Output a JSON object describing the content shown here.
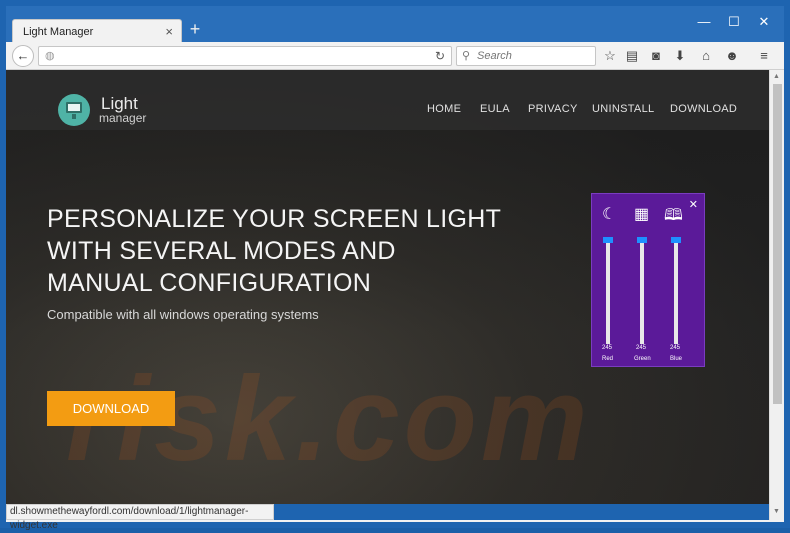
{
  "browser": {
    "tab_title": "Light Manager",
    "tab_close": "×",
    "new_tab": "+",
    "minimize": "—",
    "maximize": "☐",
    "close": "✕",
    "search_placeholder": "Search",
    "status_url": "dl.showmethewayfordl.com/download/1/lightmanager-widget.exe"
  },
  "site": {
    "logo_light": "Light",
    "logo_manager": "manager",
    "nav": [
      "HOME",
      "EULA",
      "PRIVACY",
      "UNINSTALL",
      "DOWNLOAD"
    ],
    "hero_lines": [
      "PERSONALIZE YOUR SCREEN LIGHT",
      "WITH SEVERAL MODES AND",
      "MANUAL CONFIGURATION"
    ],
    "subtitle": "Compatible with all windows operating systems",
    "download_button": "DOWNLOAD",
    "watermark": "risk.com"
  },
  "widget": {
    "icons": [
      "moon-icon",
      "clapperboard-icon",
      "book-icon"
    ],
    "close": "✕",
    "sliders": [
      {
        "value": "245",
        "label": "Red"
      },
      {
        "value": "245",
        "label": "Green"
      },
      {
        "value": "245",
        "label": "Blue"
      }
    ]
  },
  "colors": {
    "accent_orange": "#f39c12",
    "widget_purple": "#5b1a99",
    "logo_teal": "#4fb3a6",
    "browser_blue": "#1e64b0"
  }
}
